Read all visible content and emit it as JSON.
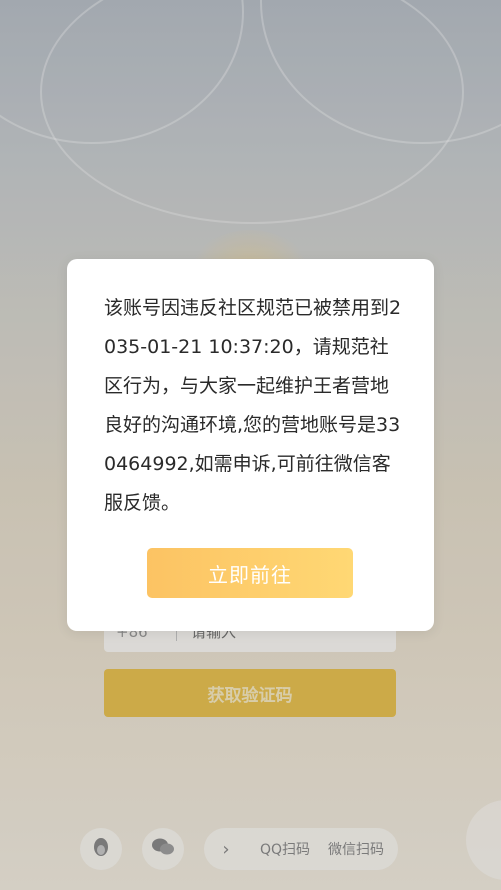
{
  "dialog": {
    "message": "该账号因违反社区规范已被禁用到2035-01-21 10:37:20，请规范社区行为，与大家一起维护王者营地良好的沟通环境,您的营地账号是330464992,如需申诉,可前往微信客服反馈。",
    "button_label": "立即前往"
  },
  "login_form": {
    "country_code": "+86",
    "phone_placeholder": "请输入",
    "get_code_label": "获取验证码"
  },
  "bottom_bar": {
    "qq_icon": "qq-penguin-icon",
    "wechat_icon": "wechat-icon",
    "expand_icon": "chevron-right-icon",
    "qq_scan_label": "QQ扫码",
    "wechat_scan_label": "微信扫码"
  },
  "colors": {
    "accent": "#fcc363",
    "get_code_bg": "#e9c253"
  }
}
